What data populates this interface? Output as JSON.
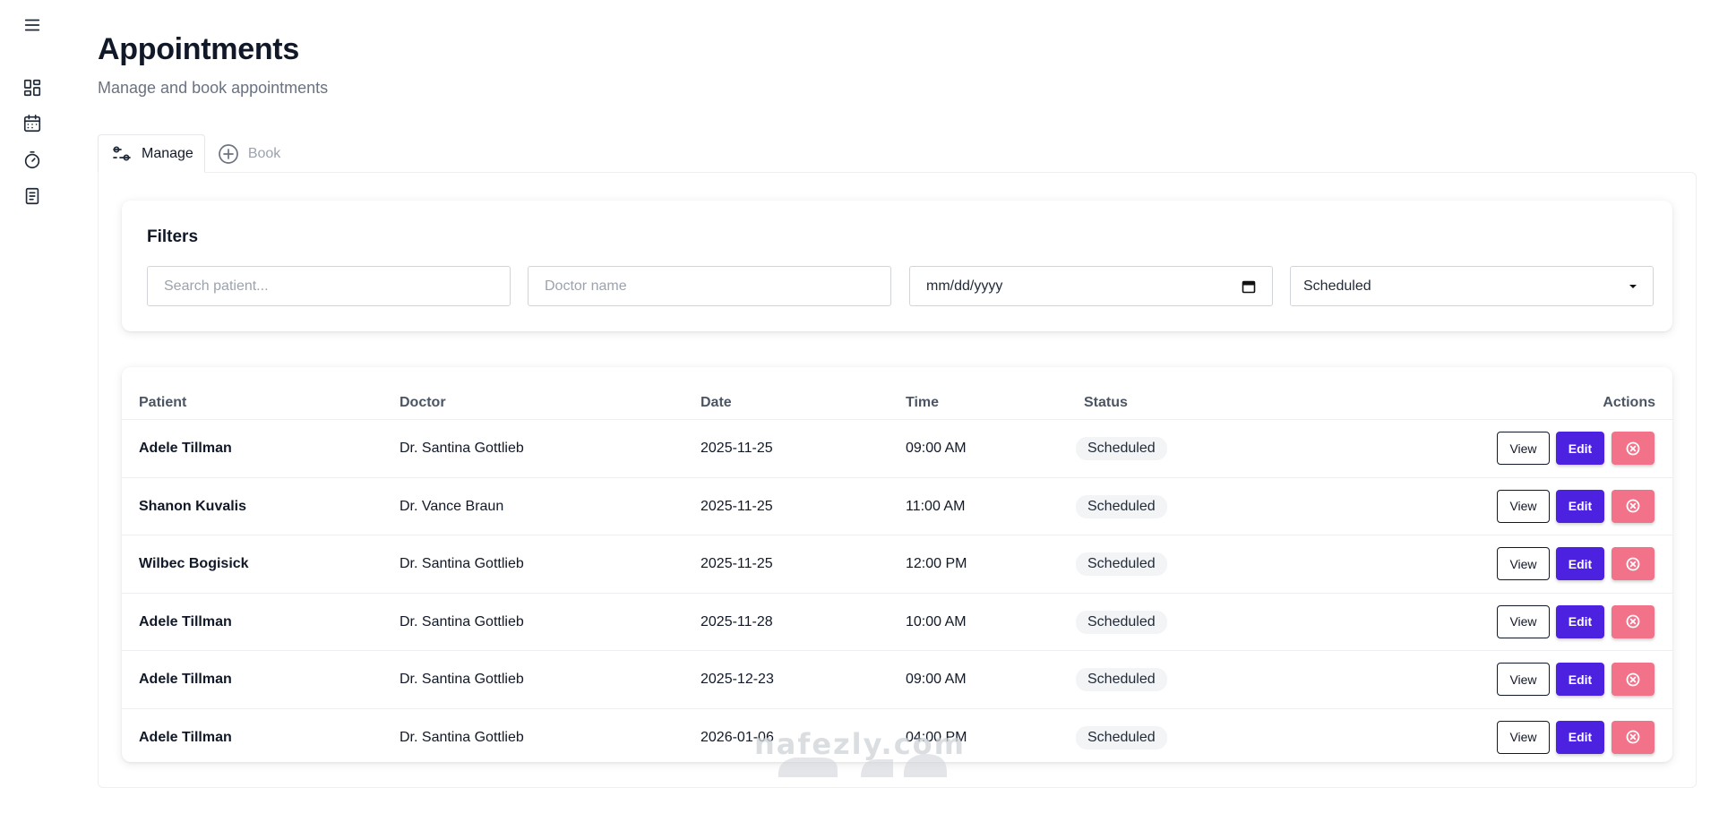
{
  "sidebar": {
    "icons": [
      "menu-icon",
      "dashboard-icon",
      "calendar-icon",
      "timer-icon",
      "document-icon"
    ]
  },
  "header": {
    "title": "Appointments",
    "subtitle": "Manage and book appointments"
  },
  "tabs": [
    {
      "label": "Manage",
      "icon": "sliders-icon",
      "active": true
    },
    {
      "label": "Book",
      "icon": "plus-circle-icon",
      "active": false
    }
  ],
  "filters": {
    "title": "Filters",
    "search_placeholder": "Search patient...",
    "doctor_placeholder": "Doctor name",
    "date_value": "mm/dd/yyyy",
    "status_value": "Scheduled"
  },
  "table": {
    "columns": [
      "Patient",
      "Doctor",
      "Date",
      "Time",
      "Status",
      "Actions"
    ],
    "rows": [
      {
        "patient": "Adele Tillman",
        "doctor": "Dr. Santina Gottlieb",
        "date": "2025-11-25",
        "time": "09:00 AM",
        "status": "Scheduled"
      },
      {
        "patient": "Shanon Kuvalis",
        "doctor": "Dr. Vance Braun",
        "date": "2025-11-25",
        "time": "11:00 AM",
        "status": "Scheduled"
      },
      {
        "patient": "Wilbec Bogisick",
        "doctor": "Dr. Santina Gottlieb",
        "date": "2025-11-25",
        "time": "12:00 PM",
        "status": "Scheduled"
      },
      {
        "patient": "Adele Tillman",
        "doctor": "Dr. Santina Gottlieb",
        "date": "2025-11-28",
        "time": "10:00 AM",
        "status": "Scheduled"
      },
      {
        "patient": "Adele Tillman",
        "doctor": "Dr. Santina Gottlieb",
        "date": "2025-12-23",
        "time": "09:00 AM",
        "status": "Scheduled"
      },
      {
        "patient": "Adele Tillman",
        "doctor": "Dr. Santina Gottlieb",
        "date": "2026-01-06",
        "time": "04:00 PM",
        "status": "Scheduled"
      }
    ],
    "actions": {
      "view": "View",
      "edit": "Edit"
    }
  },
  "watermark": {
    "text": "nafezly.com"
  },
  "colors": {
    "primary": "#4c22e0",
    "danger": "#f2728a",
    "badge_bg": "#f3f4f6",
    "muted": "#6b7280"
  }
}
